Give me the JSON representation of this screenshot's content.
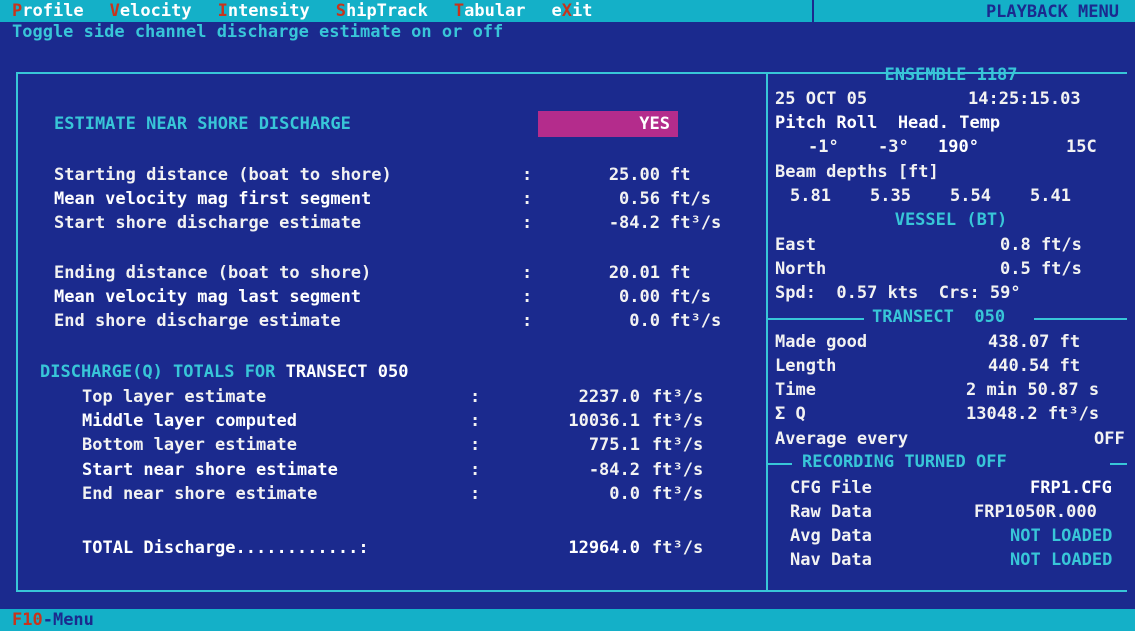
{
  "menu": {
    "items": [
      {
        "hot": "P",
        "rest": "rofile"
      },
      {
        "hot": "V",
        "rest": "elocity"
      },
      {
        "hot": "I",
        "rest": "ntensity"
      },
      {
        "hot": "S",
        "rest": "hipTrack"
      },
      {
        "hot": "T",
        "rest": "abular"
      },
      {
        "pre": "e",
        "hot": "X",
        "rest": "it"
      }
    ],
    "title": "PLAYBACK MENU"
  },
  "hint": "Toggle side channel discharge estimate on or off",
  "estimate": {
    "label": "ESTIMATE NEAR SHORE DISCHARGE",
    "value": "YES"
  },
  "start": [
    {
      "label": "Starting distance (boat to shore)",
      "value": "25.00",
      "unit": "ft"
    },
    {
      "label": "Mean velocity mag first segment",
      "value": "0.56",
      "unit": "ft/s"
    },
    {
      "label": "Start shore discharge estimate",
      "value": "-84.2",
      "unit": "ft³/s"
    }
  ],
  "end": [
    {
      "label": "Ending distance (boat to shore)",
      "value": "20.01",
      "unit": "ft"
    },
    {
      "label": "Mean velocity mag last segment",
      "value": "0.00",
      "unit": "ft/s"
    },
    {
      "label": "End shore discharge estimate",
      "value": "0.0",
      "unit": "ft³/s"
    }
  ],
  "totals": {
    "heading_a": "DISCHARGE(Q) TOTALS FOR",
    "heading_b": "TRANSECT 050",
    "rows": [
      {
        "label": "Top layer estimate",
        "value": "2237.0",
        "unit": "ft³/s"
      },
      {
        "label": "Middle layer computed",
        "value": "10036.1",
        "unit": "ft³/s"
      },
      {
        "label": "Bottom layer estimate",
        "value": "775.1",
        "unit": "ft³/s"
      },
      {
        "label": "Start near shore estimate",
        "value": "-84.2",
        "unit": "ft³/s"
      },
      {
        "label": "End near shore estimate",
        "value": "0.0",
        "unit": "ft³/s"
      }
    ],
    "total_label": "TOTAL Discharge............",
    "total_value": "12964.0",
    "total_unit": "ft³/s"
  },
  "right": {
    "ensemble": "ENSEMBLE 1187",
    "date": "25 OCT 05",
    "time": "14:25:15.03",
    "att_header": "Pitch Roll  Head. Temp",
    "pitch": "-1°",
    "roll": "-3°",
    "head": "190°",
    "temp": "15C",
    "beam_label": "Beam depths [ft]",
    "beams": [
      "5.81",
      "5.35",
      "5.54",
      "5.41"
    ],
    "vessel_heading": "VESSEL (BT)",
    "vessel": [
      {
        "label": "East",
        "value": "0.8 ft/s"
      },
      {
        "label": "North",
        "value": "0.5 ft/s"
      }
    ],
    "spd_line": "Spd:  0.57 kts  Crs: 59°",
    "transect_heading": "TRANSECT  050",
    "transect": [
      {
        "label": "Made good",
        "value": "438.07 ft"
      },
      {
        "label": "Length",
        "value": "440.54 ft"
      },
      {
        "label": "Time",
        "value": "2 min 50.87 s"
      },
      {
        "label": "Σ Q",
        "value": "13048.2 ft³/s"
      },
      {
        "label": "Average every",
        "value": "OFF"
      }
    ],
    "recording_heading": "RECORDING TURNED OFF",
    "files": [
      {
        "label": "CFG File",
        "value": "FRP1.CFG"
      },
      {
        "label": "Raw Data",
        "value": "FRP1050R.000"
      },
      {
        "label": "Avg Data",
        "value": "NOT LOADED"
      },
      {
        "label": "Nav Data",
        "value": "NOT LOADED"
      }
    ]
  },
  "status": {
    "key": "F10",
    "text": "-Menu"
  },
  "colors": {
    "background": "#1b2a8e",
    "bar": "#14b0c8",
    "accent": "#38c6d8",
    "hotkey": "#c8341c",
    "highlight": "#b42c8c"
  }
}
